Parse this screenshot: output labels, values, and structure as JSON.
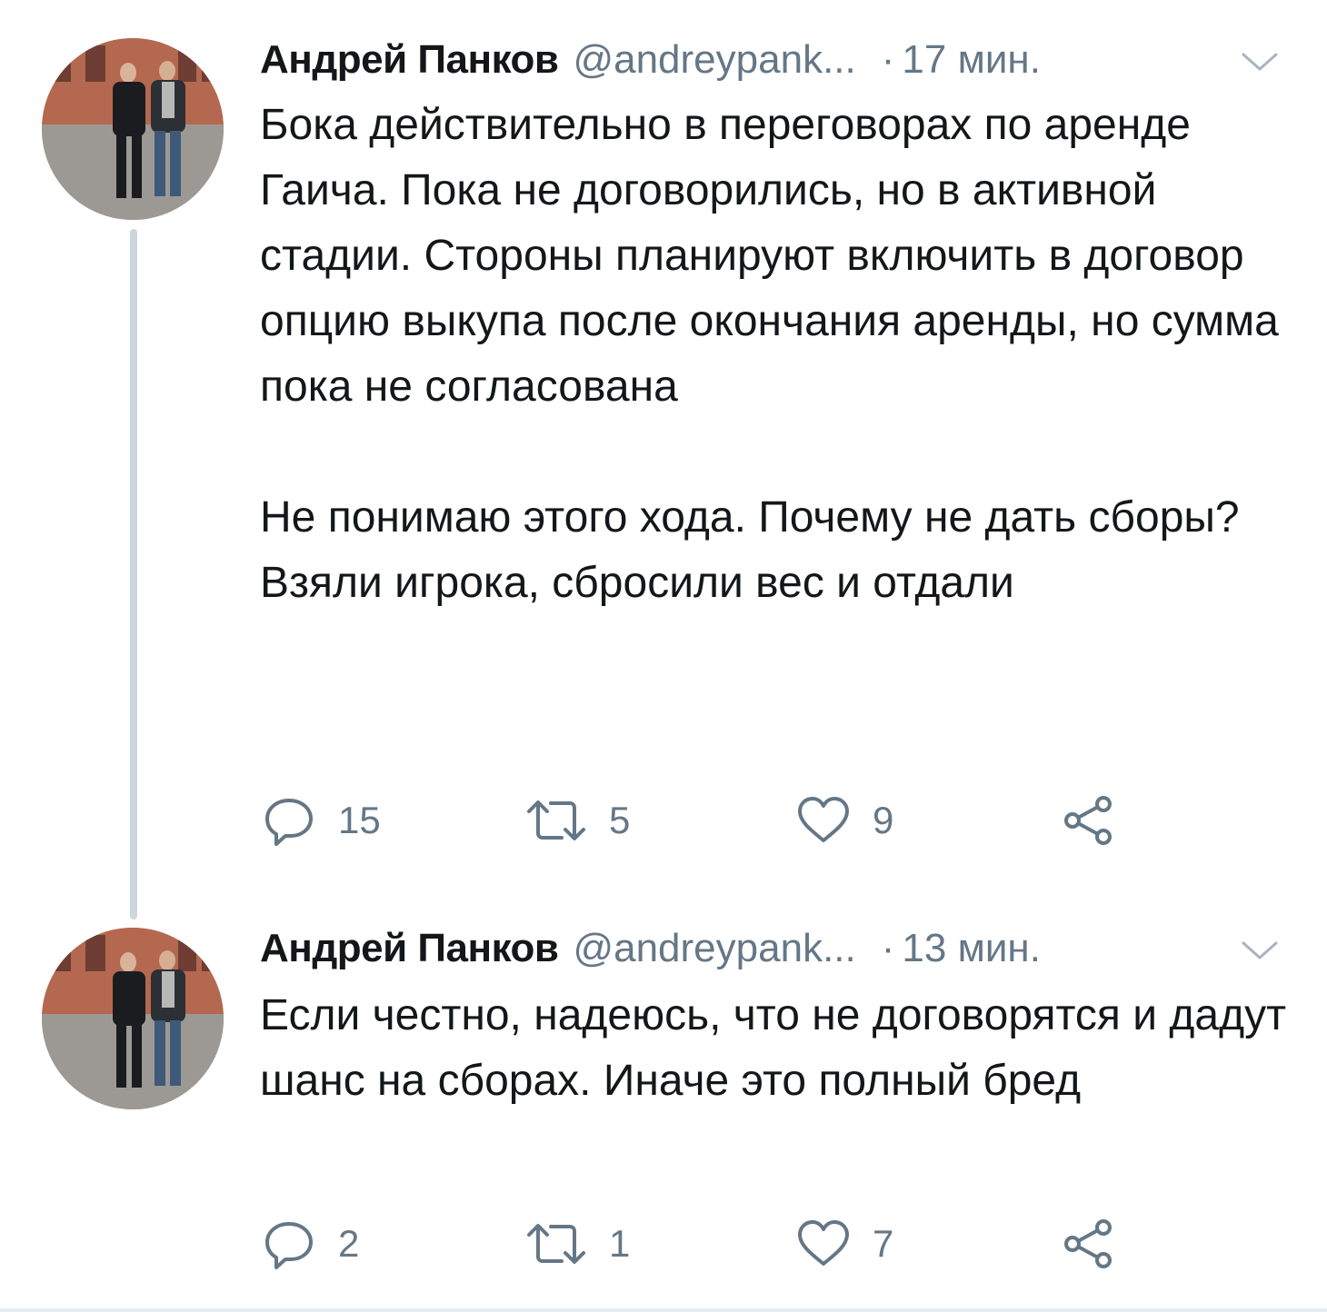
{
  "colors": {
    "text": "#14171a",
    "secondary": "#657786",
    "thread_line": "#ccd6dd"
  },
  "tweets": [
    {
      "author_name": "Андрей Панков",
      "handle": "@andreypank...",
      "separator": "·",
      "time": "17 мин.",
      "avatar_icon": "avatar-photo-two-men",
      "paragraphs": [
        "Бока действительно в переговорах по аренде Гаича. Пока не договорились, но в активной стадии. Стороны планируют включить в договор опцию выкупа после окончания аренды, но сумма пока не согласована",
        "Не понимаю этого хода. Почему не дать сборы? Взяли игрока, сбросили вес и отдали"
      ],
      "actions": {
        "reply": {
          "icon": "reply-icon",
          "count": "15"
        },
        "retweet": {
          "icon": "retweet-icon",
          "count": "5"
        },
        "like": {
          "icon": "heart-icon",
          "count": "9"
        },
        "share": {
          "icon": "share-icon"
        }
      }
    },
    {
      "author_name": "Андрей Панков",
      "handle": "@andreypank...",
      "separator": "·",
      "time": "13 мин.",
      "avatar_icon": "avatar-photo-two-men",
      "paragraphs": [
        "Если честно, надеюсь, что не договорятся и дадут шанс на сборах. Иначе это полный бред"
      ],
      "actions": {
        "reply": {
          "icon": "reply-icon",
          "count": "2"
        },
        "retweet": {
          "icon": "retweet-icon",
          "count": "1"
        },
        "like": {
          "icon": "heart-icon",
          "count": "7"
        },
        "share": {
          "icon": "share-icon"
        }
      }
    }
  ]
}
